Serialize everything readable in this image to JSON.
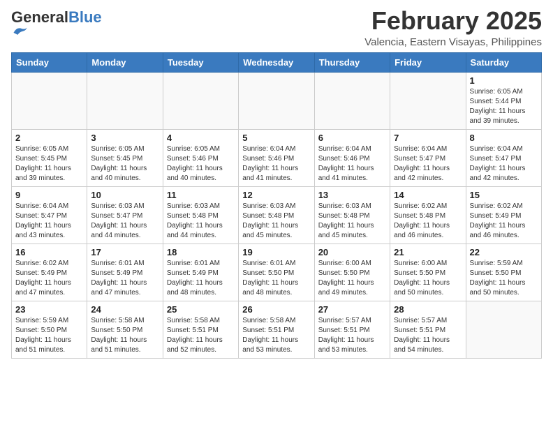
{
  "header": {
    "logo_general": "General",
    "logo_blue": "Blue",
    "month_title": "February 2025",
    "location": "Valencia, Eastern Visayas, Philippines"
  },
  "weekdays": [
    "Sunday",
    "Monday",
    "Tuesday",
    "Wednesday",
    "Thursday",
    "Friday",
    "Saturday"
  ],
  "weeks": [
    [
      {
        "day": "",
        "info": ""
      },
      {
        "day": "",
        "info": ""
      },
      {
        "day": "",
        "info": ""
      },
      {
        "day": "",
        "info": ""
      },
      {
        "day": "",
        "info": ""
      },
      {
        "day": "",
        "info": ""
      },
      {
        "day": "1",
        "info": "Sunrise: 6:05 AM\nSunset: 5:44 PM\nDaylight: 11 hours\nand 39 minutes."
      }
    ],
    [
      {
        "day": "2",
        "info": "Sunrise: 6:05 AM\nSunset: 5:45 PM\nDaylight: 11 hours\nand 39 minutes."
      },
      {
        "day": "3",
        "info": "Sunrise: 6:05 AM\nSunset: 5:45 PM\nDaylight: 11 hours\nand 40 minutes."
      },
      {
        "day": "4",
        "info": "Sunrise: 6:05 AM\nSunset: 5:46 PM\nDaylight: 11 hours\nand 40 minutes."
      },
      {
        "day": "5",
        "info": "Sunrise: 6:04 AM\nSunset: 5:46 PM\nDaylight: 11 hours\nand 41 minutes."
      },
      {
        "day": "6",
        "info": "Sunrise: 6:04 AM\nSunset: 5:46 PM\nDaylight: 11 hours\nand 41 minutes."
      },
      {
        "day": "7",
        "info": "Sunrise: 6:04 AM\nSunset: 5:47 PM\nDaylight: 11 hours\nand 42 minutes."
      },
      {
        "day": "8",
        "info": "Sunrise: 6:04 AM\nSunset: 5:47 PM\nDaylight: 11 hours\nand 42 minutes."
      }
    ],
    [
      {
        "day": "9",
        "info": "Sunrise: 6:04 AM\nSunset: 5:47 PM\nDaylight: 11 hours\nand 43 minutes."
      },
      {
        "day": "10",
        "info": "Sunrise: 6:03 AM\nSunset: 5:47 PM\nDaylight: 11 hours\nand 44 minutes."
      },
      {
        "day": "11",
        "info": "Sunrise: 6:03 AM\nSunset: 5:48 PM\nDaylight: 11 hours\nand 44 minutes."
      },
      {
        "day": "12",
        "info": "Sunrise: 6:03 AM\nSunset: 5:48 PM\nDaylight: 11 hours\nand 45 minutes."
      },
      {
        "day": "13",
        "info": "Sunrise: 6:03 AM\nSunset: 5:48 PM\nDaylight: 11 hours\nand 45 minutes."
      },
      {
        "day": "14",
        "info": "Sunrise: 6:02 AM\nSunset: 5:48 PM\nDaylight: 11 hours\nand 46 minutes."
      },
      {
        "day": "15",
        "info": "Sunrise: 6:02 AM\nSunset: 5:49 PM\nDaylight: 11 hours\nand 46 minutes."
      }
    ],
    [
      {
        "day": "16",
        "info": "Sunrise: 6:02 AM\nSunset: 5:49 PM\nDaylight: 11 hours\nand 47 minutes."
      },
      {
        "day": "17",
        "info": "Sunrise: 6:01 AM\nSunset: 5:49 PM\nDaylight: 11 hours\nand 47 minutes."
      },
      {
        "day": "18",
        "info": "Sunrise: 6:01 AM\nSunset: 5:49 PM\nDaylight: 11 hours\nand 48 minutes."
      },
      {
        "day": "19",
        "info": "Sunrise: 6:01 AM\nSunset: 5:50 PM\nDaylight: 11 hours\nand 48 minutes."
      },
      {
        "day": "20",
        "info": "Sunrise: 6:00 AM\nSunset: 5:50 PM\nDaylight: 11 hours\nand 49 minutes."
      },
      {
        "day": "21",
        "info": "Sunrise: 6:00 AM\nSunset: 5:50 PM\nDaylight: 11 hours\nand 50 minutes."
      },
      {
        "day": "22",
        "info": "Sunrise: 5:59 AM\nSunset: 5:50 PM\nDaylight: 11 hours\nand 50 minutes."
      }
    ],
    [
      {
        "day": "23",
        "info": "Sunrise: 5:59 AM\nSunset: 5:50 PM\nDaylight: 11 hours\nand 51 minutes."
      },
      {
        "day": "24",
        "info": "Sunrise: 5:58 AM\nSunset: 5:50 PM\nDaylight: 11 hours\nand 51 minutes."
      },
      {
        "day": "25",
        "info": "Sunrise: 5:58 AM\nSunset: 5:51 PM\nDaylight: 11 hours\nand 52 minutes."
      },
      {
        "day": "26",
        "info": "Sunrise: 5:58 AM\nSunset: 5:51 PM\nDaylight: 11 hours\nand 53 minutes."
      },
      {
        "day": "27",
        "info": "Sunrise: 5:57 AM\nSunset: 5:51 PM\nDaylight: 11 hours\nand 53 minutes."
      },
      {
        "day": "28",
        "info": "Sunrise: 5:57 AM\nSunset: 5:51 PM\nDaylight: 11 hours\nand 54 minutes."
      },
      {
        "day": "",
        "info": ""
      }
    ]
  ]
}
